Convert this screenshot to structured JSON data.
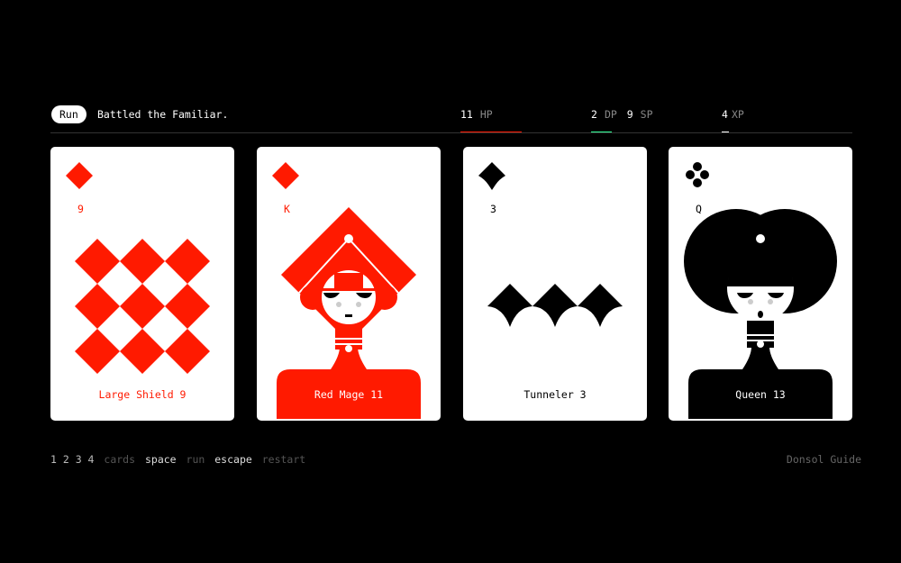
{
  "header": {
    "run_label": "Run",
    "message": "Battled the Familiar.",
    "hp": {
      "value": "11",
      "label": "HP",
      "color": "#ff1a00"
    },
    "dp": {
      "value": "2",
      "label": "DP",
      "color": "#33ff99"
    },
    "sp": {
      "value": "9",
      "label": "SP"
    },
    "xp": {
      "value": "4",
      "label": "XP",
      "color": "#ffffff"
    }
  },
  "cards": [
    {
      "suit": "diamond",
      "rank": "9",
      "name": "Large Shield 9",
      "color": "#ff1a00"
    },
    {
      "suit": "diamond",
      "rank": "K",
      "name": "Red Mage 11",
      "color": "#ff1a00"
    },
    {
      "suit": "spade",
      "rank": "3",
      "name": "Tunneler 3",
      "color": "#000000"
    },
    {
      "suit": "club",
      "rank": "Q",
      "name": "Queen 13",
      "color": "#000000"
    }
  ],
  "footer": {
    "keys": "1 2 3 4",
    "keys_desc": "cards",
    "space_key": "space",
    "space_desc": "run",
    "escape_key": "escape",
    "escape_desc": "restart",
    "guide_link": "Donsol Guide"
  }
}
